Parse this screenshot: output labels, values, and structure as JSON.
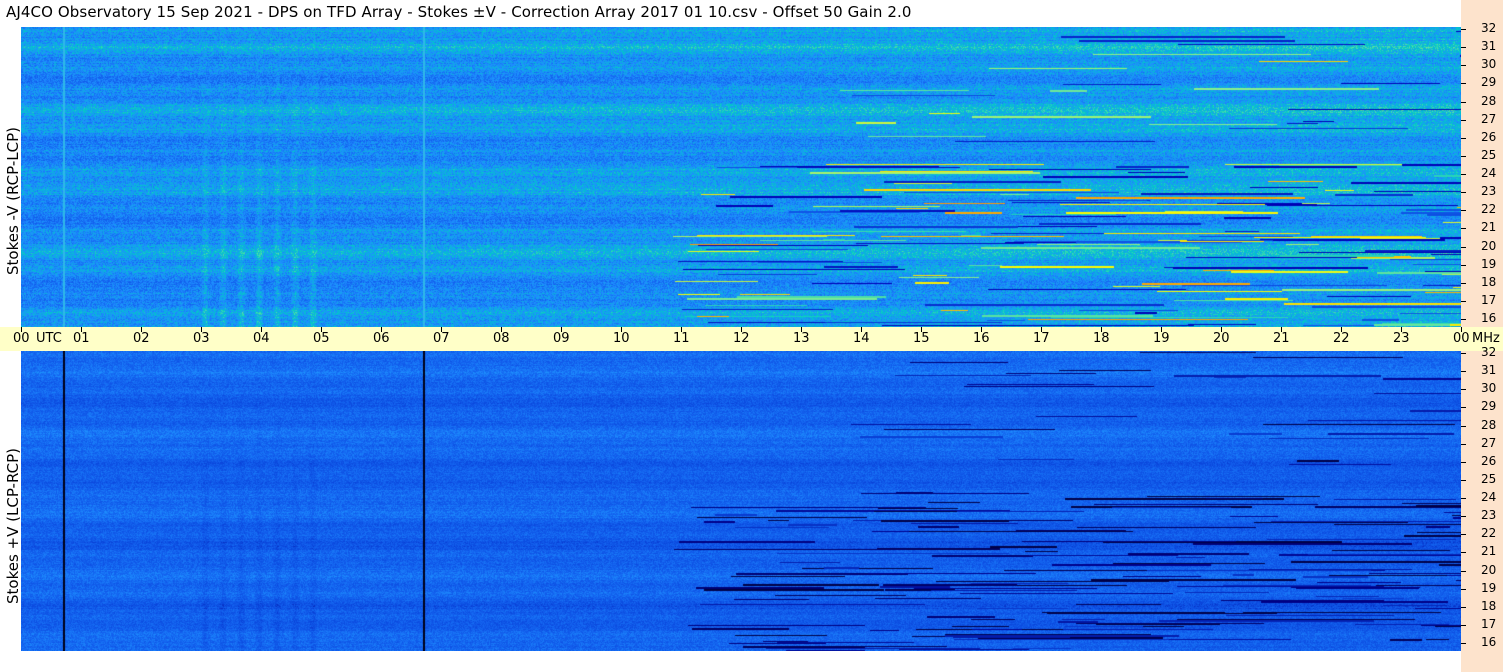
{
  "title": "AJ4CO Observatory  15 Sep 2021  -  DPS on TFD Array  -  Stokes ±V  -  Correction Array 2017 01 10.csv  -  Offset 50  Gain 2.0",
  "chart_data": [
    {
      "type": "heatmap",
      "panel": "top",
      "ylabel": "Stokes -V (RCP-LCP)",
      "y_unit": "MHz",
      "y_ticks": [
        "32",
        "31",
        "30",
        "29",
        "28",
        "27",
        "26",
        "25",
        "24",
        "23",
        "22",
        "21",
        "20",
        "19",
        "18",
        "17",
        "16"
      ],
      "ylim": [
        16,
        32
      ],
      "x_unit": "UTC",
      "xlim": [
        "00",
        "00"
      ],
      "colormap": [
        "#0000b4",
        "#0a46dc",
        "#1464f0",
        "#1e90ff",
        "#00c8c8",
        "#8cf08c",
        "#ffff00",
        "#ff8c00",
        "#ff0000"
      ],
      "vertical_lines_utc": [
        0.7,
        6.7
      ]
    },
    {
      "type": "heatmap",
      "panel": "bottom",
      "ylabel": "Stokes +V (LCP-RCP)",
      "y_unit": "MHz",
      "y_ticks": [
        "32",
        "31",
        "30",
        "29",
        "28",
        "27",
        "26",
        "25",
        "24",
        "23",
        "22",
        "21",
        "20",
        "19",
        "18",
        "17",
        "16"
      ],
      "ylim": [
        16,
        32
      ],
      "x_unit": "UTC",
      "xlim": [
        "00",
        "00"
      ],
      "colormap": [
        "#000046",
        "#00008c",
        "#0a46dc",
        "#1464f0",
        "#1e90ff",
        "#00c8c8",
        "#8cf08c"
      ],
      "vertical_lines_utc": [
        0.7,
        6.7
      ]
    }
  ],
  "time_axis": {
    "labels": [
      "00",
      "01",
      "02",
      "03",
      "04",
      "05",
      "06",
      "07",
      "08",
      "09",
      "10",
      "11",
      "12",
      "13",
      "14",
      "15",
      "16",
      "17",
      "18",
      "19",
      "20",
      "21",
      "22",
      "23",
      "00"
    ],
    "utc_label": "UTC",
    "mhz_label": "MHz"
  }
}
